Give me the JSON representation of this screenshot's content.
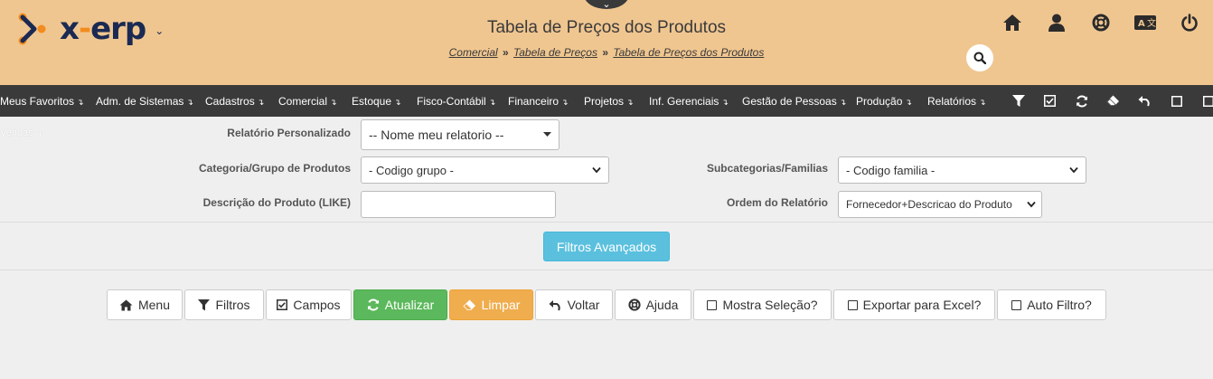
{
  "header": {
    "logo_text_a": "x",
    "logo_text_dash": "-",
    "logo_text_b": "erp",
    "logo_caret": "⌄",
    "title": "Tabela de Preços dos Produtos",
    "breadcrumb": [
      "Comercial",
      "Tabela de Preços",
      "Tabela de Preços dos Produtos"
    ],
    "breadcrumb_sep": "»",
    "top_icons": [
      "home-icon",
      "user-icon",
      "lifebuoy-icon",
      "translate-icon",
      "power-icon"
    ],
    "search_icon": "search-icon"
  },
  "nav": {
    "items": [
      "Meus Favoritos",
      "Adm. de Sistemas",
      "Cadastros",
      "Comercial",
      "Estoque",
      "Fisco-Contábil",
      "Financeiro",
      "Projetos",
      "Inf. Gerenciais",
      "Gestão de Pessoas",
      "Produção",
      "Relatórios"
    ],
    "arrow": "↴",
    "second_row": "Vendas",
    "tools": [
      "filter-icon",
      "checkbox-checked-icon",
      "refresh-icon",
      "eraser-icon",
      "undo-icon",
      "square-icon",
      "square-icon"
    ]
  },
  "filters": {
    "report_label": "Relatório Personalizado",
    "report_value": "-- Nome meu relatorio --",
    "category_label": "Categoria/Grupo de Produtos",
    "category_value": "- Codigo grupo -",
    "subcategory_label": "Subcategorias/Familias",
    "subcategory_value": "- Codigo familia -",
    "description_label": "Descrição do Produto (LIKE)",
    "description_value": "",
    "order_label": "Ordem do Relatório",
    "order_value": "Fornecedor+Descricao do Produto"
  },
  "advanced_button": "Filtros Avançados",
  "actions": {
    "menu": "Menu",
    "filtros": "Filtros",
    "campos": "Campos",
    "atualizar": "Atualizar",
    "limpar": "Limpar",
    "voltar": "Voltar",
    "ajuda": "Ajuda",
    "mostra_selecao": "Mostra Seleção?",
    "exportar_excel": "Exportar para Excel?",
    "auto_filtro": "Auto Filtro?"
  },
  "colors": {
    "header_bg": "#f0c690",
    "nav_bg": "#3a3a3a",
    "logo_orange": "#f28c1e",
    "logo_navy": "#1b2a52",
    "info": "#5bc0de",
    "success": "#5cb85c",
    "warning": "#f0ad4e"
  }
}
